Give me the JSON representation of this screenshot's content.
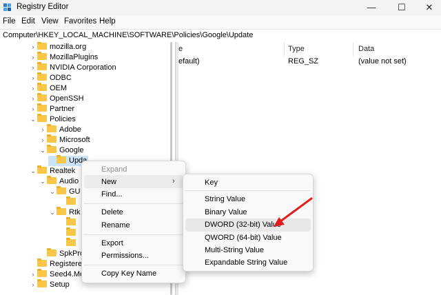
{
  "window": {
    "title": "Registry Editor",
    "minimize": "—",
    "maximize": "☐",
    "close": "✕"
  },
  "menu": [
    "File",
    "Edit",
    "View",
    "Favorites",
    "Help"
  ],
  "address": "Computer\\HKEY_LOCAL_MACHINE\\SOFTWARE\\Policies\\Google\\Update",
  "tree": [
    {
      "label": "mozilla.org",
      "arrow": "›"
    },
    {
      "label": "MozillaPlugins",
      "arrow": "›"
    },
    {
      "label": "NVIDIA Corporation",
      "arrow": "›"
    },
    {
      "label": "ODBC",
      "arrow": "›"
    },
    {
      "label": "OEM",
      "arrow": "›"
    },
    {
      "label": "OpenSSH",
      "arrow": "›"
    },
    {
      "label": "Partner",
      "arrow": "›"
    },
    {
      "label": "Policies",
      "arrow": "⌄"
    },
    {
      "label": "Adobe",
      "arrow": "›"
    },
    {
      "label": "Microsoft",
      "arrow": "›"
    },
    {
      "label": "Google",
      "arrow": "⌄"
    },
    {
      "label": "Upda",
      "arrow": ""
    },
    {
      "label": "Realtek",
      "arrow": "⌄"
    },
    {
      "label": "Audio",
      "arrow": "⌄"
    },
    {
      "label": "GU",
      "arrow": "⌄"
    },
    {
      "label": "",
      "arrow": ""
    },
    {
      "label": "Rtk",
      "arrow": "⌄"
    },
    {
      "label": "",
      "arrow": ""
    },
    {
      "label": "",
      "arrow": ""
    },
    {
      "label": "",
      "arrow": ""
    },
    {
      "label": "SpkPro",
      "arrow": ""
    },
    {
      "label": "Registere",
      "arrow": ""
    },
    {
      "label": "Seed4.Me",
      "arrow": "›"
    },
    {
      "label": "Setup",
      "arrow": "›"
    }
  ],
  "columns": {
    "name": "e",
    "type": "Type",
    "data": "Data"
  },
  "values": [
    {
      "name": "efault)",
      "type": "REG_SZ",
      "data": "(value not set)"
    }
  ],
  "context_menu": {
    "expand": "Expand",
    "new": "New",
    "find": "Find...",
    "delete": "Delete",
    "rename": "Rename",
    "export": "Export",
    "permissions": "Permissions...",
    "copy_key_name": "Copy Key Name"
  },
  "submenu": {
    "key": "Key",
    "string": "String Value",
    "binary": "Binary Value",
    "dword": "DWORD (32-bit) Value",
    "qword": "QWORD (64-bit) Value",
    "multi_string": "Multi-String Value",
    "expandable": "Expandable String Value"
  },
  "colors": {
    "folder": "#f8c74a",
    "arrow": "#e01e1e",
    "selection": "#cce4f7"
  }
}
